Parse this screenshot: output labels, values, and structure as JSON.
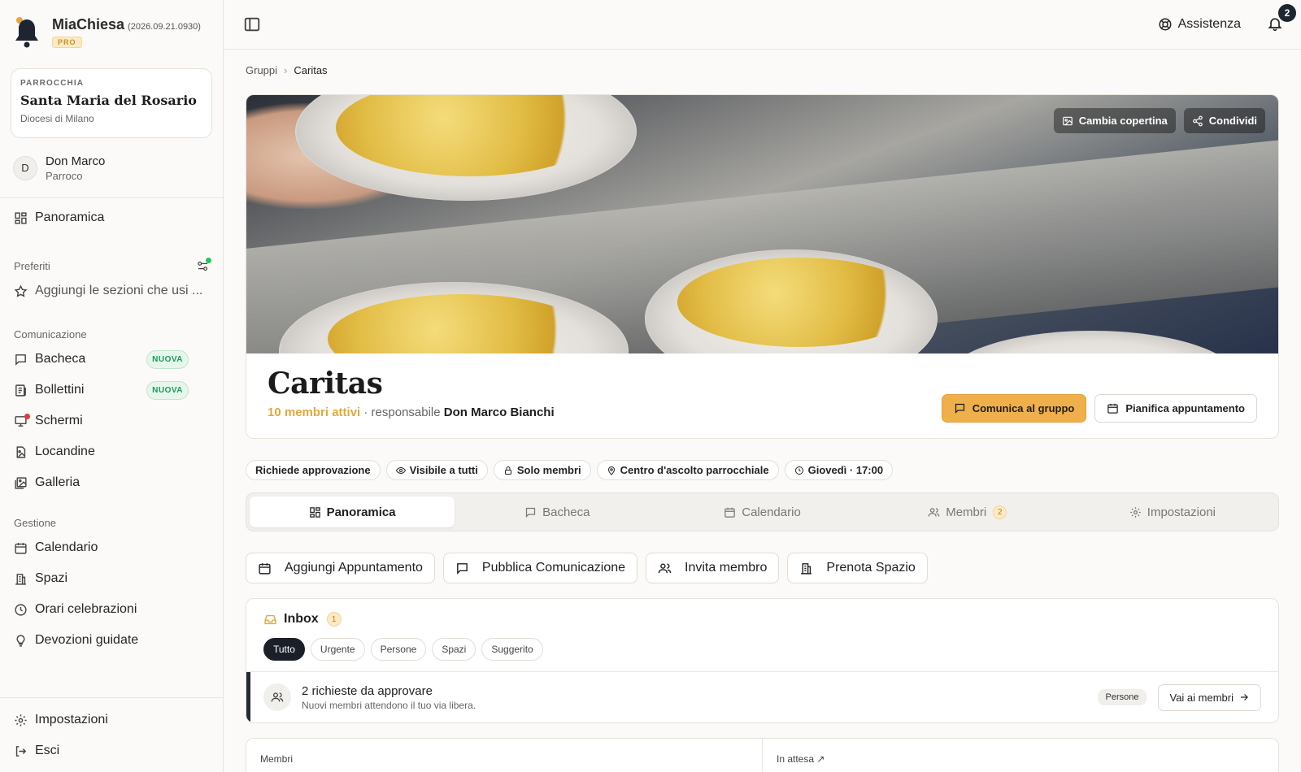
{
  "brand": {
    "name": "MiaChiesa",
    "version": "(2026.09.21.0930)",
    "plan": "PRO"
  },
  "parish": {
    "kicker": "PARROCCHIA",
    "name": "Santa Maria del Rosario",
    "diocese": "Diocesi di Milano"
  },
  "user": {
    "initial": "D",
    "name": "Don Marco",
    "role": "Parroco"
  },
  "sidebar": {
    "overview": "Panoramica",
    "favorites_label": "Preferiti",
    "favorites_hint": "Aggiungi le sezioni che usi ...",
    "communication_label": "Comunicazione",
    "communication": [
      {
        "label": "Bacheca",
        "badge": "NUOVA",
        "icon": "message-square-icon"
      },
      {
        "label": "Bollettini",
        "badge": "NUOVA",
        "icon": "newspaper-icon"
      },
      {
        "label": "Schermi",
        "badge": "",
        "icon": "monitor-icon"
      },
      {
        "label": "Locandine",
        "badge": "",
        "icon": "file-image-icon"
      },
      {
        "label": "Galleria",
        "badge": "",
        "icon": "images-icon"
      }
    ],
    "management_label": "Gestione",
    "management": [
      {
        "label": "Calendario",
        "icon": "calendar-icon"
      },
      {
        "label": "Spazi",
        "icon": "building-icon"
      },
      {
        "label": "Orari celebrazioni",
        "icon": "clock-icon"
      },
      {
        "label": "Devozioni guidate",
        "icon": "lightbulb-icon"
      }
    ],
    "settings": "Impostazioni",
    "logout": "Esci"
  },
  "topbar": {
    "help": "Assistenza",
    "notifications_count": "2"
  },
  "breadcrumb": {
    "parent": "Gruppi",
    "current": "Caritas"
  },
  "cover": {
    "change_label": "Cambia copertina",
    "share_label": "Condividi"
  },
  "group": {
    "title": "Caritas",
    "active_members": "10 membri attivi",
    "separator": " · responsabile ",
    "leader": "Don Marco Bianchi",
    "primary_action": "Comunica al gruppo",
    "secondary_action": "Pianifica appuntamento"
  },
  "chips": [
    "Richiede approvazione",
    "Visibile a tutti",
    "Solo membri",
    "Centro d'ascolto parrocchiale",
    "Giovedì · 17:00"
  ],
  "tabs": [
    {
      "label": "Panoramica",
      "count": ""
    },
    {
      "label": "Bacheca",
      "count": ""
    },
    {
      "label": "Calendario",
      "count": ""
    },
    {
      "label": "Membri",
      "count": "2"
    },
    {
      "label": "Impostazioni",
      "count": ""
    }
  ],
  "quick_actions": [
    "Aggiungi Appuntamento",
    "Pubblica Comunicazione",
    "Invita membro",
    "Prenota Spazio"
  ],
  "inbox": {
    "title": "Inbox",
    "count": "1",
    "filters": [
      "Tutto",
      "Urgente",
      "Persone",
      "Spazi",
      "Suggerito"
    ],
    "item": {
      "title": "2 richieste da approvare",
      "subtitle": "Nuovi membri attendono il tuo via libera.",
      "tag": "Persone",
      "action": "Vai ai membri"
    }
  },
  "stats": {
    "members": "Membri",
    "pending": "In attesa ↗"
  },
  "colors": {
    "accent": "#efb04b",
    "dark": "#1b1f27",
    "new_badge": "#1c9a57"
  }
}
